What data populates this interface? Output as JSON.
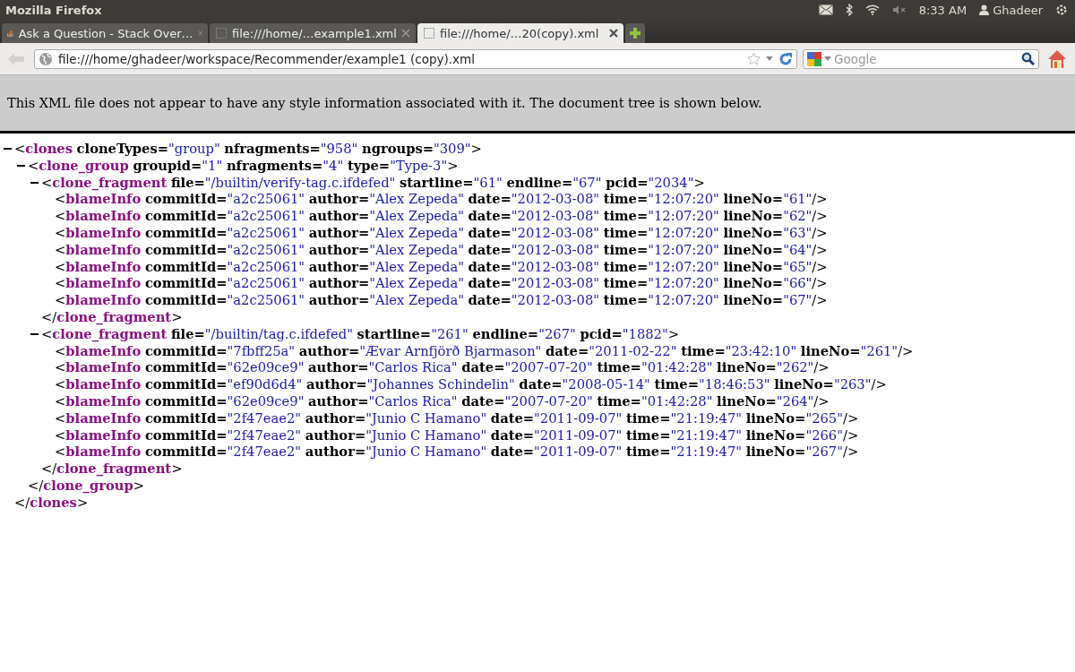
{
  "window": {
    "title": "Mozilla Firefox"
  },
  "system_tray": {
    "clock": "8:33 AM",
    "user": "Ghadeer",
    "volume_muted": true
  },
  "tabs": [
    {
      "title": "Ask a Question - Stack Over…",
      "kind": "stack",
      "selected": false
    },
    {
      "title": "file:///home/…example1.xml",
      "kind": "blank",
      "selected": false
    },
    {
      "title": "file:///home/…20(copy).xml",
      "kind": "blank",
      "selected": true
    }
  ],
  "navigation": {
    "back_disabled": true,
    "url": "file:///home/ghadeer/workspace/Recommender/example1 (copy).xml",
    "search_placeholder": "Google"
  },
  "info_banner": "This XML file does not appear to have any style information associated with it. The document tree is shown below.",
  "xml_tree": {
    "expanded": true,
    "open": "<",
    "tag": "clones",
    "attributes": [
      {
        "name": "cloneTypes=",
        "value": "\"group\""
      },
      {
        "name": "nfragments=",
        "value": "\"958\""
      },
      {
        "name": "ngroups=",
        "value": "\"309\""
      }
    ],
    "end": ">",
    "closing": {
      "open": "</",
      "tag": "clones",
      "end": ">"
    },
    "children": [
      {
        "expanded": true,
        "open": "<",
        "tag": "clone_group",
        "attributes": [
          {
            "name": "groupid=",
            "value": "\"1\""
          },
          {
            "name": "nfragments=",
            "value": "\"4\""
          },
          {
            "name": "type=",
            "value": "\"Type-3\""
          }
        ],
        "end": ">",
        "closing": {
          "open": "</",
          "tag": "clone_group",
          "end": ">"
        },
        "children": [
          {
            "expanded": true,
            "open": "<",
            "tag": "clone_fragment",
            "attributes": [
              {
                "name": "file=",
                "value": "\"/builtin/verify-tag.c.ifdefed\""
              },
              {
                "name": "startline=",
                "value": "\"61\""
              },
              {
                "name": "endline=",
                "value": "\"67\""
              },
              {
                "name": "pcid=",
                "value": "\"2034\""
              }
            ],
            "end": ">",
            "closing": {
              "open": "</",
              "tag": "clone_fragment",
              "end": ">"
            },
            "children": [
              {
                "open": "<",
                "tag": "blameInfo",
                "attributes": [
                  {
                    "name": "commitId=",
                    "value": "\"a2c25061\""
                  },
                  {
                    "name": "author=",
                    "value": "\"Alex Zepeda\""
                  },
                  {
                    "name": "date=",
                    "value": "\"2012-03-08\""
                  },
                  {
                    "name": "time=",
                    "value": "\"12:07:20\""
                  },
                  {
                    "name": "lineNo=",
                    "value": "\"61\""
                  }
                ],
                "end": "/>"
              },
              {
                "open": "<",
                "tag": "blameInfo",
                "attributes": [
                  {
                    "name": "commitId=",
                    "value": "\"a2c25061\""
                  },
                  {
                    "name": "author=",
                    "value": "\"Alex Zepeda\""
                  },
                  {
                    "name": "date=",
                    "value": "\"2012-03-08\""
                  },
                  {
                    "name": "time=",
                    "value": "\"12:07:20\""
                  },
                  {
                    "name": "lineNo=",
                    "value": "\"62\""
                  }
                ],
                "end": "/>"
              },
              {
                "open": "<",
                "tag": "blameInfo",
                "attributes": [
                  {
                    "name": "commitId=",
                    "value": "\"a2c25061\""
                  },
                  {
                    "name": "author=",
                    "value": "\"Alex Zepeda\""
                  },
                  {
                    "name": "date=",
                    "value": "\"2012-03-08\""
                  },
                  {
                    "name": "time=",
                    "value": "\"12:07:20\""
                  },
                  {
                    "name": "lineNo=",
                    "value": "\"63\""
                  }
                ],
                "end": "/>"
              },
              {
                "open": "<",
                "tag": "blameInfo",
                "attributes": [
                  {
                    "name": "commitId=",
                    "value": "\"a2c25061\""
                  },
                  {
                    "name": "author=",
                    "value": "\"Alex Zepeda\""
                  },
                  {
                    "name": "date=",
                    "value": "\"2012-03-08\""
                  },
                  {
                    "name": "time=",
                    "value": "\"12:07:20\""
                  },
                  {
                    "name": "lineNo=",
                    "value": "\"64\""
                  }
                ],
                "end": "/>"
              },
              {
                "open": "<",
                "tag": "blameInfo",
                "attributes": [
                  {
                    "name": "commitId=",
                    "value": "\"a2c25061\""
                  },
                  {
                    "name": "author=",
                    "value": "\"Alex Zepeda\""
                  },
                  {
                    "name": "date=",
                    "value": "\"2012-03-08\""
                  },
                  {
                    "name": "time=",
                    "value": "\"12:07:20\""
                  },
                  {
                    "name": "lineNo=",
                    "value": "\"65\""
                  }
                ],
                "end": "/>"
              },
              {
                "open": "<",
                "tag": "blameInfo",
                "attributes": [
                  {
                    "name": "commitId=",
                    "value": "\"a2c25061\""
                  },
                  {
                    "name": "author=",
                    "value": "\"Alex Zepeda\""
                  },
                  {
                    "name": "date=",
                    "value": "\"2012-03-08\""
                  },
                  {
                    "name": "time=",
                    "value": "\"12:07:20\""
                  },
                  {
                    "name": "lineNo=",
                    "value": "\"66\""
                  }
                ],
                "end": "/>"
              },
              {
                "open": "<",
                "tag": "blameInfo",
                "attributes": [
                  {
                    "name": "commitId=",
                    "value": "\"a2c25061\""
                  },
                  {
                    "name": "author=",
                    "value": "\"Alex Zepeda\""
                  },
                  {
                    "name": "date=",
                    "value": "\"2012-03-08\""
                  },
                  {
                    "name": "time=",
                    "value": "\"12:07:20\""
                  },
                  {
                    "name": "lineNo=",
                    "value": "\"67\""
                  }
                ],
                "end": "/>"
              }
            ]
          },
          {
            "expanded": true,
            "open": "<",
            "tag": "clone_fragment",
            "attributes": [
              {
                "name": "file=",
                "value": "\"/builtin/tag.c.ifdefed\""
              },
              {
                "name": "startline=",
                "value": "\"261\""
              },
              {
                "name": "endline=",
                "value": "\"267\""
              },
              {
                "name": "pcid=",
                "value": "\"1882\""
              }
            ],
            "end": ">",
            "closing": {
              "open": "</",
              "tag": "clone_fragment",
              "end": ">"
            },
            "children": [
              {
                "open": "<",
                "tag": "blameInfo",
                "attributes": [
                  {
                    "name": "commitId=",
                    "value": "\"7fbff25a\""
                  },
                  {
                    "name": "author=",
                    "value": "\"Ævar Arnfjörð Bjarmason\""
                  },
                  {
                    "name": "date=",
                    "value": "\"2011-02-22\""
                  },
                  {
                    "name": "time=",
                    "value": "\"23:42:10\""
                  },
                  {
                    "name": "lineNo=",
                    "value": "\"261\""
                  }
                ],
                "end": "/>"
              },
              {
                "open": "<",
                "tag": "blameInfo",
                "attributes": [
                  {
                    "name": "commitId=",
                    "value": "\"62e09ce9\""
                  },
                  {
                    "name": "author=",
                    "value": "\"Carlos Rica\""
                  },
                  {
                    "name": "date=",
                    "value": "\"2007-07-20\""
                  },
                  {
                    "name": "time=",
                    "value": "\"01:42:28\""
                  },
                  {
                    "name": "lineNo=",
                    "value": "\"262\""
                  }
                ],
                "end": "/>"
              },
              {
                "open": "<",
                "tag": "blameInfo",
                "attributes": [
                  {
                    "name": "commitId=",
                    "value": "\"ef90d6d4\""
                  },
                  {
                    "name": "author=",
                    "value": "\"Johannes Schindelin\""
                  },
                  {
                    "name": "date=",
                    "value": "\"2008-05-14\""
                  },
                  {
                    "name": "time=",
                    "value": "\"18:46:53\""
                  },
                  {
                    "name": "lineNo=",
                    "value": "\"263\""
                  }
                ],
                "end": "/>"
              },
              {
                "open": "<",
                "tag": "blameInfo",
                "attributes": [
                  {
                    "name": "commitId=",
                    "value": "\"62e09ce9\""
                  },
                  {
                    "name": "author=",
                    "value": "\"Carlos Rica\""
                  },
                  {
                    "name": "date=",
                    "value": "\"2007-07-20\""
                  },
                  {
                    "name": "time=",
                    "value": "\"01:42:28\""
                  },
                  {
                    "name": "lineNo=",
                    "value": "\"264\""
                  }
                ],
                "end": "/>"
              },
              {
                "open": "<",
                "tag": "blameInfo",
                "attributes": [
                  {
                    "name": "commitId=",
                    "value": "\"2f47eae2\""
                  },
                  {
                    "name": "author=",
                    "value": "\"Junio C Hamano\""
                  },
                  {
                    "name": "date=",
                    "value": "\"2011-09-07\""
                  },
                  {
                    "name": "time=",
                    "value": "\"21:19:47\""
                  },
                  {
                    "name": "lineNo=",
                    "value": "\"265\""
                  }
                ],
                "end": "/>"
              },
              {
                "open": "<",
                "tag": "blameInfo",
                "attributes": [
                  {
                    "name": "commitId=",
                    "value": "\"2f47eae2\""
                  },
                  {
                    "name": "author=",
                    "value": "\"Junio C Hamano\""
                  },
                  {
                    "name": "date=",
                    "value": "\"2011-09-07\""
                  },
                  {
                    "name": "time=",
                    "value": "\"21:19:47\""
                  },
                  {
                    "name": "lineNo=",
                    "value": "\"266\""
                  }
                ],
                "end": "/>"
              },
              {
                "open": "<",
                "tag": "blameInfo",
                "attributes": [
                  {
                    "name": "commitId=",
                    "value": "\"2f47eae2\""
                  },
                  {
                    "name": "author=",
                    "value": "\"Junio C Hamano\""
                  },
                  {
                    "name": "date=",
                    "value": "\"2011-09-07\""
                  },
                  {
                    "name": "time=",
                    "value": "\"21:19:47\""
                  },
                  {
                    "name": "lineNo=",
                    "value": "\"267\""
                  }
                ],
                "end": "/>"
              }
            ]
          }
        ]
      }
    ]
  }
}
